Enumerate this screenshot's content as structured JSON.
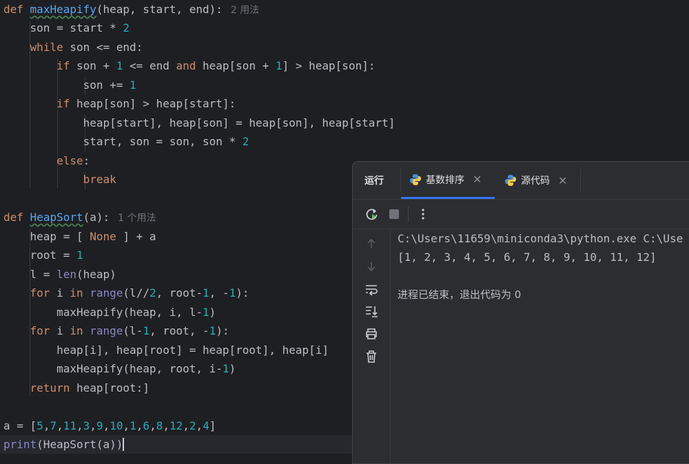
{
  "editor": {
    "hints": {
      "maxheapify_usages": "2 用法",
      "heapsort_usages": "1 个用法"
    }
  },
  "run_panel": {
    "title": "运行",
    "tabs": [
      {
        "label": "基数排序",
        "icon": "python-icon",
        "active": true
      },
      {
        "label": "源代码",
        "icon": "python-icon",
        "active": false
      }
    ],
    "toolbar": [
      "rerun-icon",
      "stop-icon",
      "more-options-icon"
    ],
    "sidebar": [
      "up-arrow-icon",
      "down-arrow-icon",
      "soft-wrap-icon",
      "scroll-to-end-icon",
      "print-icon",
      "trash-icon"
    ],
    "console": {
      "command": "C:\\Users\\11659\\miniconda3\\python.exe C:\\Use",
      "output": "[1, 2, 3, 4, 5, 6, 7, 8, 9, 10, 11, 12]",
      "exit_message": "进程已结束，退出代码为 0"
    }
  },
  "colors": {
    "editor_bg": "#1e1f22",
    "keyword": "#cf8e6d",
    "function": "#56a8f5",
    "number": "#2aacb8",
    "builtin": "#8888c6",
    "accent": "#3574f0"
  }
}
